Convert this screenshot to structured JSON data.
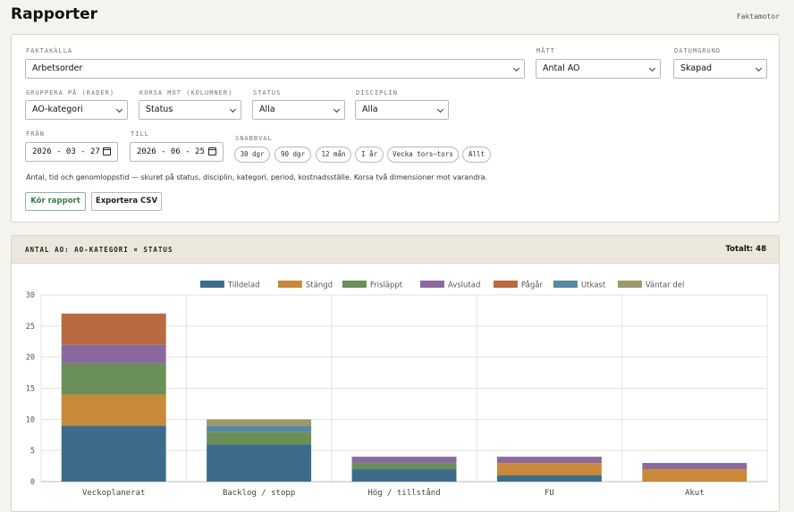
{
  "header": {
    "title": "Rapporter",
    "brand": "Faktamotor"
  },
  "filters": {
    "faktakalla": {
      "label": "FAKTAKÄLLA",
      "value": "Arbetsorder"
    },
    "matt": {
      "label": "MÅTT",
      "value": "Antal AO"
    },
    "datumgrund": {
      "label": "DATUMGRUND",
      "value": "Skapad"
    },
    "gruppera": {
      "label": "GRUPPERA PÅ (RADER)",
      "value": "AO-kategori"
    },
    "korsa": {
      "label": "KORSA MOT (KOLUMNER)",
      "value": "Status"
    },
    "status": {
      "label": "STATUS",
      "value": "Alla"
    },
    "disciplin": {
      "label": "DISCIPLIN",
      "value": "Alla"
    },
    "fran": {
      "label": "FRÅN",
      "value": "2026 - 03 - 27"
    },
    "till": {
      "label": "TILL",
      "value": "2026 - 06 - 25"
    },
    "snabbval": {
      "label": "SNABBVAL",
      "chips": [
        "30 dgr",
        "90 dgr",
        "12 mån",
        "I år",
        "Vecka tors–tors",
        "Allt"
      ]
    },
    "description": "Antal, tid och genomloppstid — skuret på status, disciplin, kategori, period, kostnadsställe. Korsa två dimensioner mot varandra.",
    "run_label": "Kör rapport",
    "export_label": "Exportera CSV"
  },
  "chart_panel": {
    "title": "ANTAL AO: AO-KATEGORI × STATUS",
    "total": "Totalt: 48"
  },
  "chart_data": {
    "type": "bar",
    "stacked": true,
    "categories": [
      "Veckoplanerat",
      "Backlog / stopp",
      "Hög / tillstånd",
      "FU",
      "Akut"
    ],
    "ylim": [
      0,
      30
    ],
    "yticks": [
      0,
      5,
      10,
      15,
      20,
      25,
      30
    ],
    "legend_position": "top-center",
    "grid": true,
    "series": [
      {
        "name": "Tilldelad",
        "color": "#3d6b8a",
        "values": [
          9,
          6,
          2,
          1,
          0
        ]
      },
      {
        "name": "Stängd",
        "color": "#c8893a",
        "values": [
          5,
          0,
          0,
          2,
          2
        ]
      },
      {
        "name": "Frisläppt",
        "color": "#6a8f57",
        "values": [
          5,
          2,
          1,
          0,
          0
        ]
      },
      {
        "name": "Avslutad",
        "color": "#8a6a9e",
        "values": [
          3,
          0,
          1,
          1,
          1
        ]
      },
      {
        "name": "Pågår",
        "color": "#b86a40",
        "values": [
          5,
          0,
          0,
          0,
          0
        ]
      },
      {
        "name": "Utkast",
        "color": "#5a87a3",
        "values": [
          0,
          1,
          0,
          0,
          0
        ]
      },
      {
        "name": "Väntar del",
        "color": "#9a9a6a",
        "values": [
          0,
          1,
          0,
          0,
          0
        ]
      }
    ]
  }
}
